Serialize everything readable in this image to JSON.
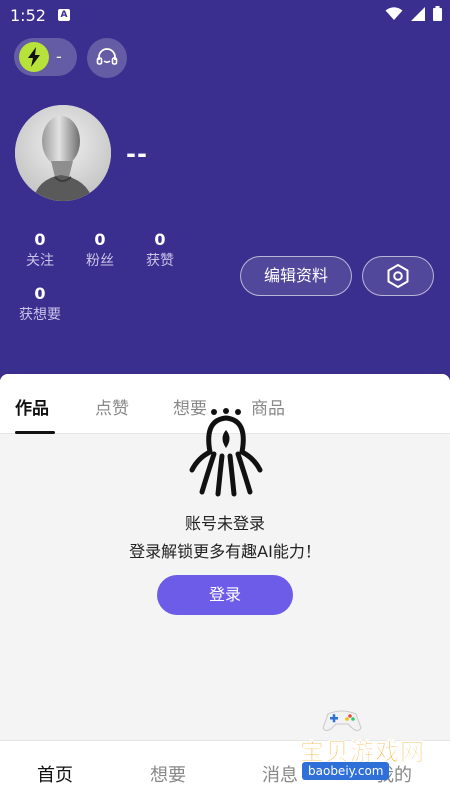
{
  "status_bar": {
    "time": "1:52",
    "notification_icon": "A",
    "icons": [
      "wifi-icon",
      "signal-icon",
      "battery-icon"
    ]
  },
  "header": {
    "energy_value": "-",
    "energy_icon": "lightning-icon",
    "support_icon": "headset-icon",
    "username": "--"
  },
  "stats": [
    {
      "value": "0",
      "label": "关注"
    },
    {
      "value": "0",
      "label": "粉丝"
    },
    {
      "value": "0",
      "label": "获赞"
    },
    {
      "value": "0",
      "label": "获想要"
    }
  ],
  "actions": {
    "edit_profile": "编辑资料",
    "settings_icon": "hexagon-settings-icon"
  },
  "tabs": [
    {
      "label": "作品",
      "active": true
    },
    {
      "label": "点赞",
      "active": false
    },
    {
      "label": "想要",
      "active": false
    },
    {
      "label": "商品",
      "active": false
    }
  ],
  "empty_state": {
    "title": "账号未登录",
    "subtitle": "登录解锁更多有趣AI能力！",
    "login_button": "登录"
  },
  "bottom_nav": [
    {
      "label": "首页",
      "active": true
    },
    {
      "label": "想要",
      "active": false
    },
    {
      "label": "消息",
      "active": false
    },
    {
      "label": "我的",
      "active": false
    }
  ],
  "watermark": {
    "title": "宝贝游戏网",
    "url": "baobeiy.com"
  },
  "colors": {
    "header_bg": "#3a2f8e",
    "accent": "#6c5ce7",
    "energy": "#b6e23a"
  }
}
